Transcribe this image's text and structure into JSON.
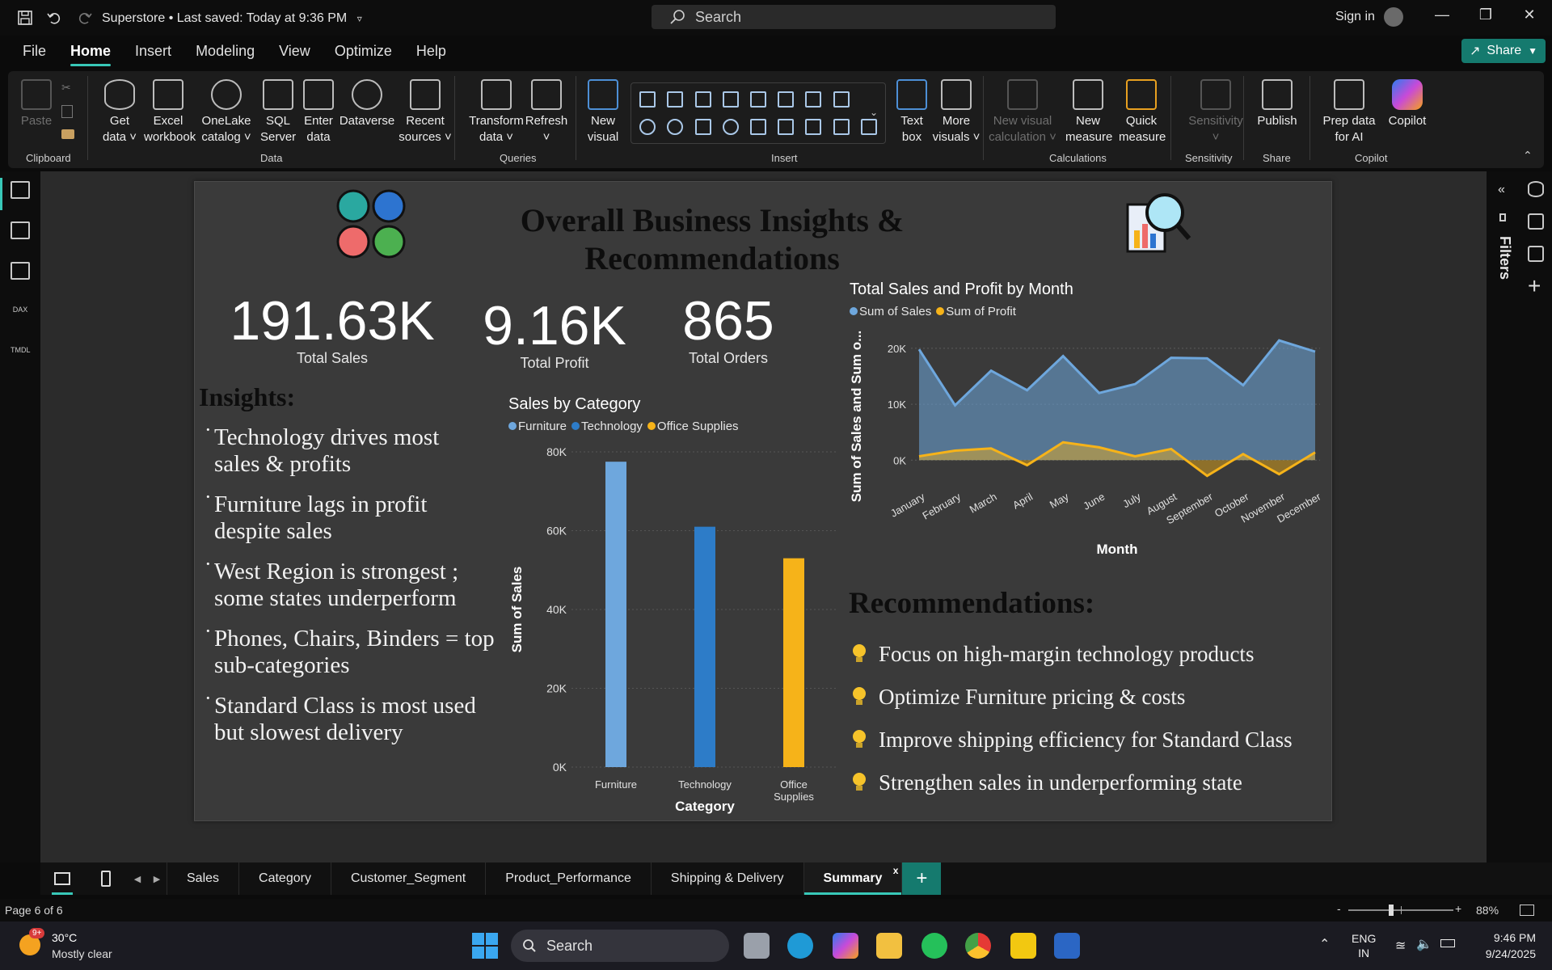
{
  "window": {
    "doc_title": "Superstore • Last saved: Today at 9:36 PM",
    "search_placeholder": "Search",
    "signin": "Sign in"
  },
  "menu": {
    "tabs": [
      "File",
      "Home",
      "Insert",
      "Modeling",
      "View",
      "Optimize",
      "Help"
    ],
    "active": "Home",
    "share": "Share"
  },
  "ribbon": {
    "buttons": {
      "paste": "Paste",
      "get_data": "Get data ˅",
      "excel": "Excel workbook",
      "onelake": "OneLake catalog ˅",
      "sql": "SQL Server",
      "enter_data": "Enter data",
      "dataverse": "Dataverse",
      "recent": "Recent sources ˅",
      "transform": "Transform data ˅",
      "refresh": "Refresh",
      "refresh_more": "˅",
      "new_visual": "New visual",
      "text_box": "Text box",
      "more_visuals": "More visuals ˅",
      "new_visual_calc": "New visual calculation ˅",
      "new_measure": "New measure",
      "quick_measure": "Quick measure",
      "sensitivity": "Sensitivity",
      "sensitivity_more": "˅",
      "publish": "Publish",
      "prep_data": "Prep data for AI",
      "copilot": "Copilot"
    },
    "groups": {
      "clipboard": "Clipboard",
      "data": "Data",
      "queries": "Queries",
      "insert": "Insert",
      "calculations": "Calculations",
      "sensitivity": "Sensitivity",
      "share": "Share",
      "copilot": "Copilot"
    }
  },
  "report": {
    "title": "Overall Business Insights & Recommendations",
    "kpis": [
      {
        "value": "191.63K",
        "label": "Total Sales"
      },
      {
        "value": "9.16K",
        "label": "Total Profit"
      },
      {
        "value": "865",
        "label": "Total Orders"
      }
    ],
    "insights_heading": "Insights:",
    "insights": [
      "Technology drives most sales & profits",
      "Furniture lags in profit despite sales",
      "West Region is strongest ; some states underperform",
      "Phones, Chairs, Binders = top sub-categories",
      "Standard Class is most used but slowest delivery"
    ],
    "recommendations_heading": "Recommendations:",
    "recommendations": [
      "Focus on high-margin technology products",
      "Optimize Furniture pricing & costs",
      "Improve shipping efficiency for Standard Class",
      "Strengthen sales in underperforming state"
    ]
  },
  "chart_data": [
    {
      "type": "bar",
      "title": "Sales by Category",
      "categories": [
        "Furniture",
        "Technology",
        "Office Supplies"
      ],
      "values": [
        77500,
        61000,
        53000
      ],
      "colors": [
        "#6ea7dd",
        "#2d7cc8",
        "#f6b319"
      ],
      "legend": [
        "Furniture",
        "Technology",
        "Office Supplies"
      ],
      "xlabel": "Category",
      "ylabel": "Sum of Sales",
      "yticks": [
        "0K",
        "20K",
        "40K",
        "60K",
        "80K"
      ],
      "ylim": [
        0,
        80000
      ],
      "grid": true
    },
    {
      "type": "area",
      "title": "Total Sales and Profit by Month",
      "categories": [
        "January",
        "February",
        "March",
        "April",
        "May",
        "June",
        "July",
        "August",
        "September",
        "October",
        "November",
        "December"
      ],
      "series": [
        {
          "name": "Sum of Sales",
          "color": "#6ea7dd",
          "values": [
            19800,
            9800,
            16000,
            12500,
            18600,
            12000,
            13600,
            18300,
            18200,
            13400,
            21400,
            19400
          ]
        },
        {
          "name": "Sum of Profit",
          "color": "#f6b319",
          "values": [
            700,
            1700,
            2100,
            -900,
            3200,
            2300,
            700,
            2000,
            -2800,
            1100,
            -2500,
            1400
          ]
        }
      ],
      "xlabel": "Month",
      "ylabel": "Sum of Sales and Sum o...",
      "yticks": [
        "0K",
        "10K",
        "20K"
      ],
      "ylim": [
        -4000,
        22000
      ],
      "grid": true
    }
  ],
  "pages": {
    "tabs": [
      "Sales",
      "Category",
      "Customer_Segment",
      "Product_Performance",
      "Shipping & Delivery",
      "Summary"
    ],
    "active": "Summary",
    "close": "x",
    "add": "+"
  },
  "right_panel": {
    "filters_label": "Filters"
  },
  "status": {
    "page": "Page 6 of 6",
    "zoom": "88%",
    "zoom_minus": "-",
    "zoom_plus": "+"
  },
  "taskbar": {
    "weather_temp": "30°C",
    "weather_desc": "Mostly clear",
    "weather_badge": "9+",
    "search": "Search",
    "lang": "ENG",
    "region": "IN",
    "time": "9:46 PM",
    "date": "9/24/2025"
  }
}
